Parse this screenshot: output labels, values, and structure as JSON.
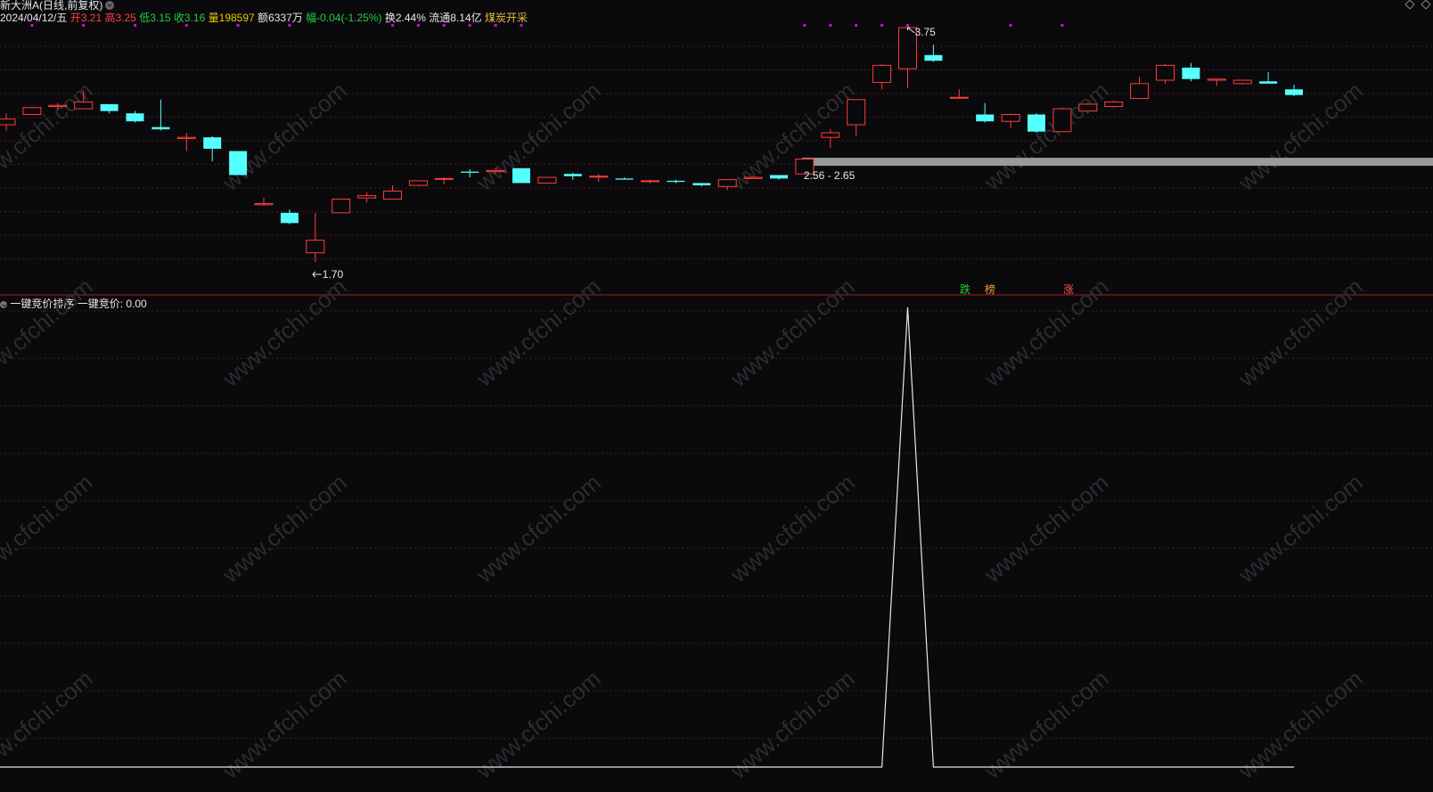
{
  "header": {
    "title": "新大洲A(日线,前复权)",
    "date": "2024/04/12/五",
    "open_label": "开",
    "open": "3.21",
    "high_label": "高",
    "high": "3.25",
    "low_label": "低",
    "low": "3.15",
    "close_label": "收",
    "close": "3.16",
    "volume_label": "量",
    "volume": "198597",
    "amount_label": "额",
    "amount": "6337万",
    "change_label": "幅",
    "change": "-0.04(-1.25%)",
    "turnover_label": "换",
    "turnover": "2.44%",
    "float_label": "流通",
    "float": "8.14亿",
    "sector": "煤炭开采"
  },
  "annotations": {
    "high_marker": "3.75",
    "low_marker": "1.70",
    "band_label": "2.56 - 2.65",
    "tag_die": "跌",
    "tag_bang": "榜",
    "tag_zhang": "涨"
  },
  "indicator": {
    "name": "一键竞价排序",
    "value_label": "一键竞价: 0.00"
  },
  "colors": {
    "up": "#ff3d3d",
    "down": "#54ffff",
    "grid": "#5a1414",
    "band": "#9a9a9a",
    "magenta": "#e000e0",
    "background": "#0a0a0c"
  },
  "chart_data": [
    {
      "type": "candlestick",
      "title": "新大洲A(日线,前复权)",
      "series": [
        {
          "name": "K线",
          "candles": [
            {
              "o": 2.9,
              "h": 3.0,
              "l": 2.85,
              "c": 2.95
            },
            {
              "o": 2.99,
              "h": 3.06,
              "l": 2.99,
              "c": 3.05
            },
            {
              "o": 3.06,
              "h": 3.09,
              "l": 3.03,
              "c": 3.07
            },
            {
              "o": 3.04,
              "h": 3.2,
              "l": 3.04,
              "c": 3.1
            },
            {
              "o": 3.08,
              "h": 3.08,
              "l": 3.0,
              "c": 3.02
            },
            {
              "o": 3.0,
              "h": 3.02,
              "l": 2.92,
              "c": 2.93
            },
            {
              "o": 2.88,
              "h": 3.12,
              "l": 2.85,
              "c": 2.86
            },
            {
              "o": 2.78,
              "h": 2.83,
              "l": 2.67,
              "c": 2.79
            },
            {
              "o": 2.79,
              "h": 2.8,
              "l": 2.58,
              "c": 2.69
            },
            {
              "o": 2.67,
              "h": 2.67,
              "l": 2.46,
              "c": 2.46
            },
            {
              "o": 2.2,
              "h": 2.26,
              "l": 2.19,
              "c": 2.21
            },
            {
              "o": 2.13,
              "h": 2.16,
              "l": 2.03,
              "c": 2.04
            },
            {
              "o": 1.78,
              "h": 2.13,
              "l": 1.7,
              "c": 1.89
            },
            {
              "o": 2.13,
              "h": 2.25,
              "l": 2.13,
              "c": 2.25
            },
            {
              "o": 2.26,
              "h": 2.31,
              "l": 2.22,
              "c": 2.28
            },
            {
              "o": 2.25,
              "h": 2.37,
              "l": 2.25,
              "c": 2.32
            },
            {
              "o": 2.37,
              "h": 2.41,
              "l": 2.36,
              "c": 2.41
            },
            {
              "o": 2.43,
              "h": 2.44,
              "l": 2.38,
              "c": 2.43
            },
            {
              "o": 2.49,
              "h": 2.51,
              "l": 2.44,
              "c": 2.48
            },
            {
              "o": 2.49,
              "h": 2.52,
              "l": 2.47,
              "c": 2.5
            },
            {
              "o": 2.52,
              "h": 2.51,
              "l": 2.41,
              "c": 2.39
            },
            {
              "o": 2.39,
              "h": 2.44,
              "l": 2.39,
              "c": 2.44
            },
            {
              "o": 2.47,
              "h": 2.48,
              "l": 2.42,
              "c": 2.45
            },
            {
              "o": 2.45,
              "h": 2.47,
              "l": 2.4,
              "c": 2.45
            },
            {
              "o": 2.43,
              "h": 2.44,
              "l": 2.42,
              "c": 2.42
            },
            {
              "o": 2.41,
              "h": 2.42,
              "l": 2.39,
              "c": 2.41
            },
            {
              "o": 2.41,
              "h": 2.42,
              "l": 2.39,
              "c": 2.4
            },
            {
              "o": 2.39,
              "h": 2.39,
              "l": 2.36,
              "c": 2.37
            },
            {
              "o": 2.36,
              "h": 2.42,
              "l": 2.33,
              "c": 2.42
            },
            {
              "o": 2.43,
              "h": 2.44,
              "l": 2.43,
              "c": 2.44
            },
            {
              "o": 2.46,
              "h": 2.46,
              "l": 2.42,
              "c": 2.43
            },
            {
              "o": 2.47,
              "h": 2.6,
              "l": 2.47,
              "c": 2.6
            },
            {
              "o": 2.79,
              "h": 2.86,
              "l": 2.7,
              "c": 2.83
            },
            {
              "o": 2.9,
              "h": 3.12,
              "l": 2.8,
              "c": 3.12
            },
            {
              "o": 3.27,
              "h": 3.43,
              "l": 3.21,
              "c": 3.42
            },
            {
              "o": 3.39,
              "h": 3.75,
              "l": 3.22,
              "c": 3.75
            },
            {
              "o": 3.51,
              "h": 3.6,
              "l": 3.45,
              "c": 3.46
            },
            {
              "o": 3.14,
              "h": 3.21,
              "l": 3.13,
              "c": 3.14
            },
            {
              "o": 2.99,
              "h": 3.09,
              "l": 2.92,
              "c": 2.93
            },
            {
              "o": 2.93,
              "h": 3.0,
              "l": 2.87,
              "c": 2.99
            },
            {
              "o": 2.99,
              "h": 3.0,
              "l": 2.83,
              "c": 2.84
            },
            {
              "o": 2.84,
              "h": 3.05,
              "l": 2.84,
              "c": 3.04
            },
            {
              "o": 3.02,
              "h": 3.09,
              "l": 3.0,
              "c": 3.08
            },
            {
              "o": 3.06,
              "h": 3.11,
              "l": 3.05,
              "c": 3.1
            },
            {
              "o": 3.13,
              "h": 3.32,
              "l": 3.13,
              "c": 3.26
            },
            {
              "o": 3.29,
              "h": 3.43,
              "l": 3.26,
              "c": 3.42
            },
            {
              "o": 3.4,
              "h": 3.44,
              "l": 3.28,
              "c": 3.3
            },
            {
              "o": 3.29,
              "h": 3.3,
              "l": 3.24,
              "c": 3.3
            },
            {
              "o": 3.26,
              "h": 3.29,
              "l": 3.25,
              "c": 3.29
            },
            {
              "o": 3.28,
              "h": 3.36,
              "l": 3.27,
              "c": 3.26
            },
            {
              "o": 3.21,
              "h": 3.25,
              "l": 3.15,
              "c": 3.16
            }
          ]
        }
      ],
      "band": {
        "low": 2.56,
        "high": 2.65
      },
      "magenta_markers": [
        1,
        3,
        5,
        7,
        9,
        11,
        15,
        16,
        17,
        18,
        19,
        20,
        31,
        32,
        33,
        34,
        35,
        39,
        41
      ],
      "grid": true
    },
    {
      "type": "line",
      "title": "一键竞价排序",
      "series": [
        {
          "name": "一键竞价",
          "values": [
            0,
            0,
            0,
            0,
            0,
            0,
            0,
            0,
            0,
            0,
            0,
            0,
            0,
            0,
            0,
            0,
            0,
            0,
            0,
            0,
            0,
            0,
            0,
            0,
            0,
            0,
            0,
            0,
            0,
            0,
            0,
            0,
            0,
            0,
            0,
            1,
            0,
            0,
            0,
            0,
            0,
            0,
            0,
            0,
            0,
            0,
            0,
            0,
            0,
            0,
            0
          ]
        }
      ],
      "grid": true
    }
  ]
}
